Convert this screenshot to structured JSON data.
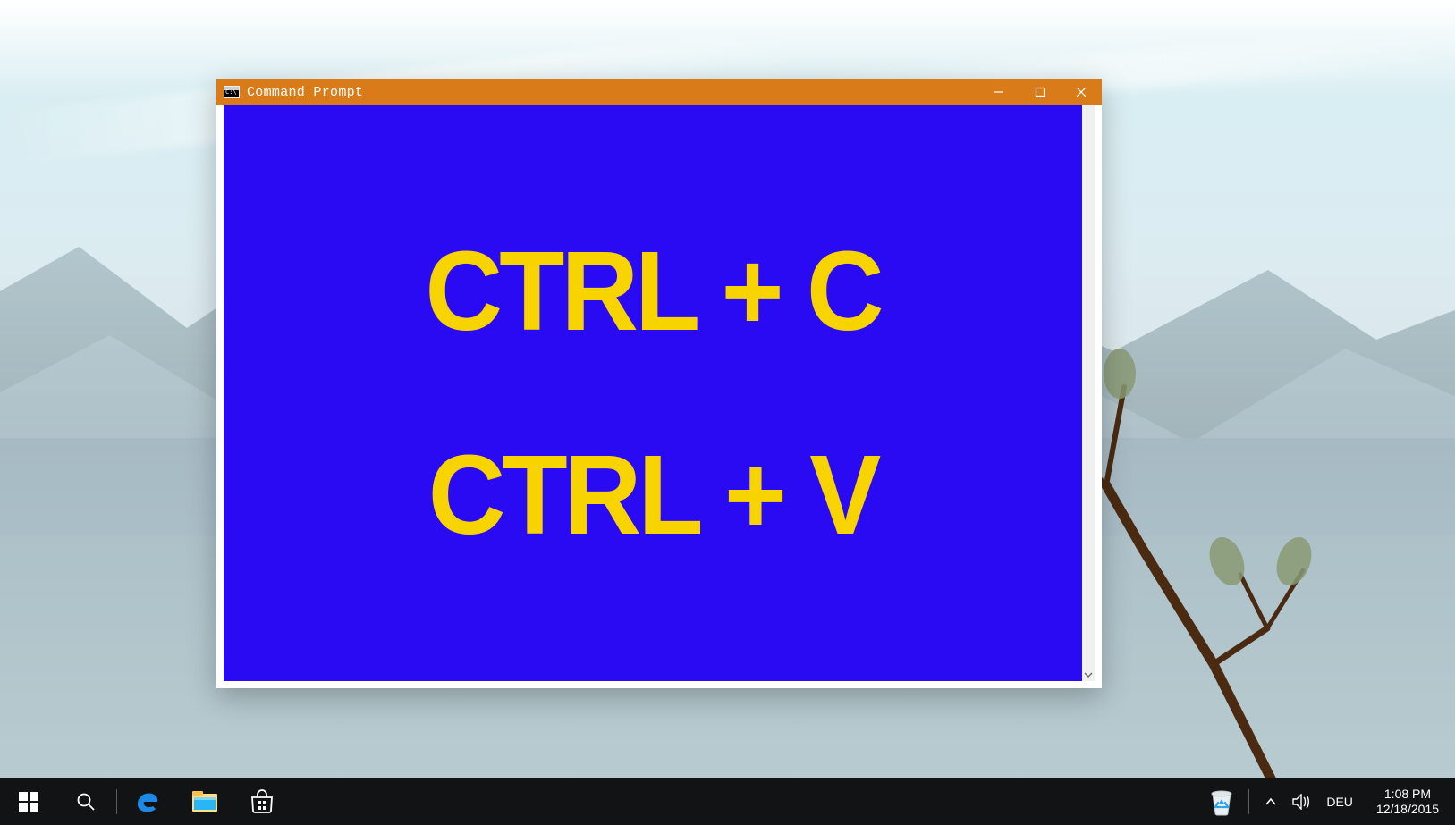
{
  "window": {
    "title": "Command Prompt",
    "overlay_line1": "CTRL + C",
    "overlay_line2": "CTRL + V"
  },
  "taskbar": {
    "language": "DEU",
    "clock_time": "1:08 PM",
    "clock_date": "12/18/2015"
  }
}
